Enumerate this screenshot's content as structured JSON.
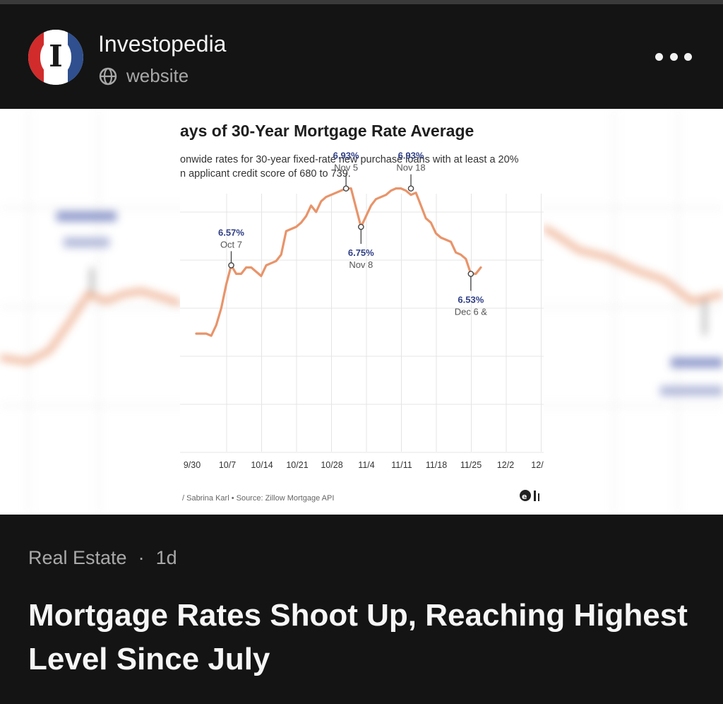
{
  "publisher": {
    "name": "Investopedia",
    "avatar_letter": "I",
    "site_label": "website",
    "colors": {
      "red": "#d22b2b",
      "blue": "#2f4f8f"
    }
  },
  "icons": {
    "globe": "globe-icon",
    "more": "more-options-icon",
    "logo": "chart-logo-icon"
  },
  "post": {
    "category": "Real Estate",
    "separator": "·",
    "age": "1d",
    "headline": "Mortgage Rates Shoot Up, Reaching Highest Level Since July"
  },
  "chart_image": {
    "title": "ays of 30-Year Mortgage Rate Average",
    "subtitle_line1": "onwide rates for 30-year fixed-rate new purchase loans with at least a 20%",
    "subtitle_line2": "n applicant credit score of 680 to 739.",
    "credit": "/ Sabrina Karl • Source: Zillow Mortgage API",
    "logo_text": "ⵕI",
    "line_color": "#e8946a",
    "label_color": "#2f3f86"
  },
  "chart_data": {
    "type": "line",
    "title": "ays of 30-Year Mortgage Rate Average",
    "subtitle": "onwide rates for 30-year fixed-rate new purchase loans with at least a 20% n applicant credit score of 680 to 739.",
    "xlabel": "",
    "ylabel": "",
    "x_ticks": [
      "9/30",
      "10/7",
      "10/14",
      "10/21",
      "10/28",
      "11/4",
      "11/11",
      "11/18",
      "11/25",
      "12/2",
      "12/"
    ],
    "ylim": [
      5.85,
      7.1
    ],
    "grid": true,
    "series": [
      {
        "values": [
          {
            "day": 0,
            "rate": 6.25
          },
          {
            "day": 2,
            "rate": 6.25
          },
          {
            "day": 3,
            "rate": 6.24
          },
          {
            "day": 4,
            "rate": 6.29
          },
          {
            "day": 5,
            "rate": 6.37
          },
          {
            "day": 6,
            "rate": 6.48
          },
          {
            "day": 7,
            "rate": 6.57
          },
          {
            "day": 8,
            "rate": 6.53
          },
          {
            "day": 9,
            "rate": 6.53
          },
          {
            "day": 10,
            "rate": 6.56
          },
          {
            "day": 11,
            "rate": 6.56
          },
          {
            "day": 12,
            "rate": 6.54
          },
          {
            "day": 13,
            "rate": 6.52
          },
          {
            "day": 14,
            "rate": 6.57
          },
          {
            "day": 15,
            "rate": 6.58
          },
          {
            "day": 16,
            "rate": 6.59
          },
          {
            "day": 17,
            "rate": 6.62
          },
          {
            "day": 18,
            "rate": 6.73
          },
          {
            "day": 19,
            "rate": 6.74
          },
          {
            "day": 20,
            "rate": 6.75
          },
          {
            "day": 21,
            "rate": 6.77
          },
          {
            "day": 22,
            "rate": 6.8
          },
          {
            "day": 23,
            "rate": 6.85
          },
          {
            "day": 24,
            "rate": 6.82
          },
          {
            "day": 25,
            "rate": 6.87
          },
          {
            "day": 26,
            "rate": 6.89
          },
          {
            "day": 27,
            "rate": 6.9
          },
          {
            "day": 28,
            "rate": 6.91
          },
          {
            "day": 29,
            "rate": 6.92
          },
          {
            "day": 30,
            "rate": 6.93
          },
          {
            "day": 31,
            "rate": 6.93
          },
          {
            "day": 32,
            "rate": 6.84
          },
          {
            "day": 33,
            "rate": 6.75
          },
          {
            "day": 34,
            "rate": 6.8
          },
          {
            "day": 35,
            "rate": 6.85
          },
          {
            "day": 36,
            "rate": 6.88
          },
          {
            "day": 37,
            "rate": 6.89
          },
          {
            "day": 38,
            "rate": 6.9
          },
          {
            "day": 39,
            "rate": 6.92
          },
          {
            "day": 40,
            "rate": 6.93
          },
          {
            "day": 41,
            "rate": 6.93
          },
          {
            "day": 42,
            "rate": 6.92
          },
          {
            "day": 43,
            "rate": 6.9
          },
          {
            "day": 44,
            "rate": 6.91
          },
          {
            "day": 45,
            "rate": 6.85
          },
          {
            "day": 46,
            "rate": 6.79
          },
          {
            "day": 47,
            "rate": 6.77
          },
          {
            "day": 48,
            "rate": 6.72
          },
          {
            "day": 49,
            "rate": 6.7
          },
          {
            "day": 50,
            "rate": 6.69
          },
          {
            "day": 51,
            "rate": 6.68
          },
          {
            "day": 52,
            "rate": 6.63
          },
          {
            "day": 53,
            "rate": 6.62
          },
          {
            "day": 54,
            "rate": 6.6
          },
          {
            "day": 55,
            "rate": 6.53
          },
          {
            "day": 56,
            "rate": 6.53
          },
          {
            "day": 57,
            "rate": 6.56
          }
        ]
      }
    ],
    "annotations": [
      {
        "day": 7,
        "rate": 6.57,
        "value": "6.57%",
        "date": "Oct 7",
        "position": "above"
      },
      {
        "day": 30,
        "rate": 6.93,
        "value": "6.93%",
        "date": "Nov 5",
        "position": "above"
      },
      {
        "day": 33,
        "rate": 6.75,
        "value": "6.75%",
        "date": "Nov 8",
        "position": "below"
      },
      {
        "day": 43,
        "rate": 6.93,
        "value": "6.93%",
        "date": "Nov 18",
        "position": "above"
      },
      {
        "day": 55,
        "rate": 6.53,
        "value": "6.53%",
        "date": "Dec 6 &",
        "position": "below"
      }
    ]
  }
}
